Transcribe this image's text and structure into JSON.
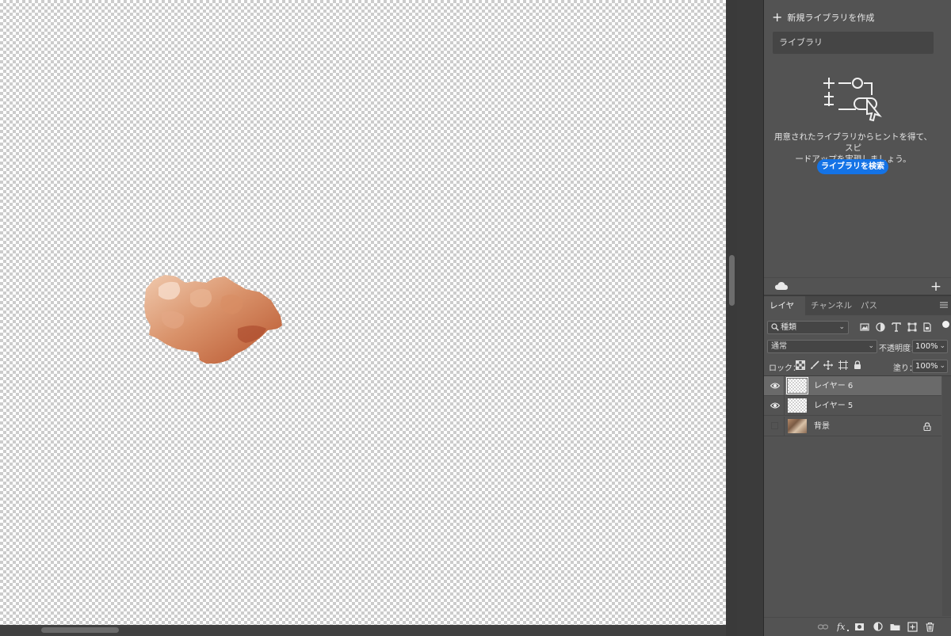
{
  "canvas": {
    "transparency_grid": "checkerboard",
    "object": "orange-brown cloud shaped cutout"
  },
  "libraries": {
    "create_new_label": "新規ライブラリを作成",
    "library_select_value": "ライブラリ",
    "hint_text_line1": "用意されたライブラリからヒントを得て、スピ",
    "hint_text_line2": "ードアップを実現しましょう。",
    "search_button_label": "ライブラリを検索",
    "accent_color": "#1473e6"
  },
  "tabs": [
    {
      "label": "レイヤー",
      "active": true
    },
    {
      "label": "チャンネル",
      "active": false
    },
    {
      "label": "パス",
      "active": false
    }
  ],
  "layers_panel": {
    "filter_kind_value": "種類",
    "blend_mode_value": "通常",
    "opacity_label": "不透明度：",
    "opacity_value": "100%",
    "lock_label": "ロック：",
    "fill_label": "塗り：",
    "fill_value": "100%",
    "filter_icons": [
      "pixel-filter-icon",
      "adjustment-filter-icon",
      "type-filter-icon",
      "shape-filter-icon",
      "smart-object-filter-icon"
    ],
    "lock_icons": [
      "lock-transparent-pixels-icon",
      "lock-image-pixels-icon",
      "lock-position-icon",
      "lock-artboard-icon",
      "lock-all-icon"
    ],
    "layers": [
      {
        "name": "レイヤー 6",
        "visible": true,
        "selected": true
      },
      {
        "name": "レイヤー 5",
        "visible": true,
        "selected": false
      },
      {
        "name": "背景",
        "visible": false,
        "selected": false,
        "locked": true
      }
    ],
    "bottom_icons": [
      "link-layers-icon",
      "fx-icon",
      "add-mask-icon",
      "adjustment-layer-icon",
      "new-group-icon",
      "new-layer-icon",
      "delete-icon"
    ]
  }
}
